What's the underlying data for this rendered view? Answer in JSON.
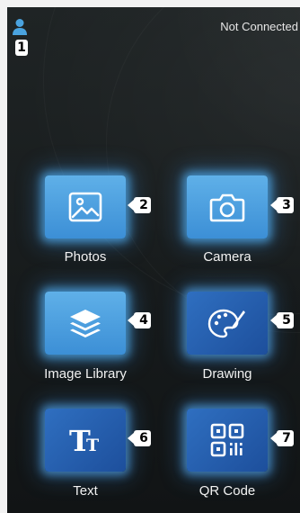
{
  "status": {
    "connection": "Not Connected"
  },
  "user_badge": "1",
  "tiles": [
    {
      "label": "Photos",
      "badge": "2",
      "icon": "image-icon"
    },
    {
      "label": "Camera",
      "badge": "3",
      "icon": "camera-icon"
    },
    {
      "label": "Image Library",
      "badge": "4",
      "icon": "layers-icon"
    },
    {
      "label": "Drawing",
      "badge": "5",
      "icon": "palette-icon"
    },
    {
      "label": "Text",
      "badge": "6",
      "icon": "text-icon"
    },
    {
      "label": "QR Code",
      "badge": "7",
      "icon": "qr-code-icon"
    }
  ],
  "colors": {
    "accent": "#3c8fd6",
    "tile_dark": "#1d4f9c",
    "user_icon": "#4aa3df",
    "background": "#1a1e1f"
  }
}
